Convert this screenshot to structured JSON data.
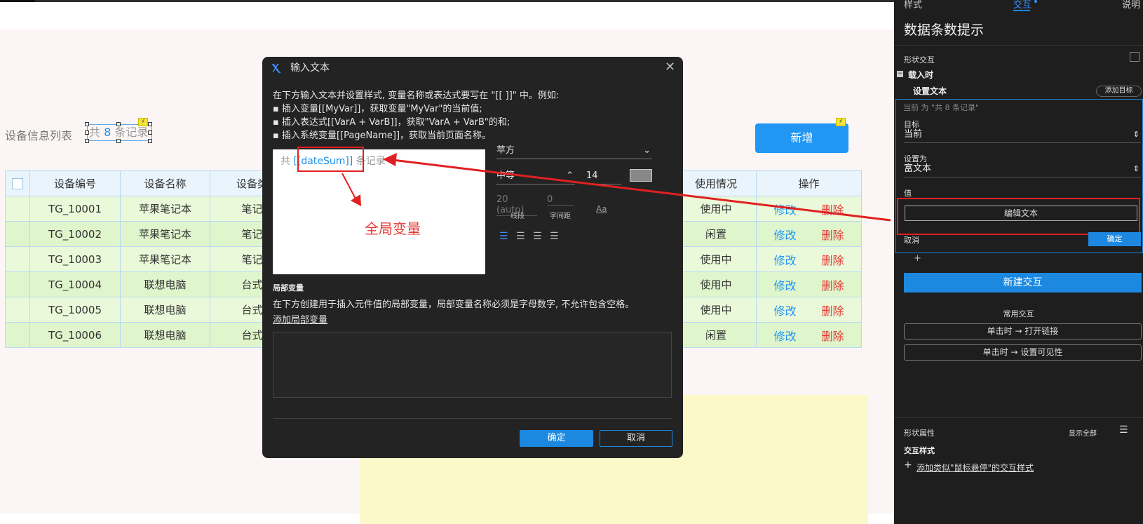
{
  "canvas": {
    "list_title": "设备信息列表",
    "count_prefix": "共",
    "count_value": "8",
    "count_suffix": "条记录",
    "add_button": "新增",
    "table": {
      "headers": [
        "设备编号",
        "设备名称",
        "设备类",
        "使用情况",
        "操作"
      ],
      "rows": [
        {
          "id": "TG_10001",
          "name": "苹果笔记本",
          "type": "笔记",
          "status": "使用中"
        },
        {
          "id": "TG_10002",
          "name": "苹果笔记本",
          "type": "笔记",
          "status": "闲置"
        },
        {
          "id": "TG_10003",
          "name": "苹果笔记本",
          "type": "笔记",
          "status": "使用中"
        },
        {
          "id": "TG_10004",
          "name": "联想电脑",
          "type": "台式",
          "status": "使用中"
        },
        {
          "id": "TG_10005",
          "name": "联想电脑",
          "type": "台式",
          "status": "使用中"
        },
        {
          "id": "TG_10006",
          "name": "联想电脑",
          "type": "台式",
          "status": "闲置"
        }
      ],
      "edit_label": "修改",
      "delete_label": "删除"
    }
  },
  "dialog": {
    "title": "输入文本",
    "instructions": [
      "在下方输入文本并设置样式, 变量名称或表达式要写在 \"[[ ]]\" 中。例如:",
      "▪ 插入变量[[MyVar]]，获取变量\"MyVar\"的当前值;",
      "▪ 插入表达式[[VarA + VarB]]，获取\"VarA + VarB\"的和;",
      "▪ 插入系统变量[[PageName]]，获取当前页面名称。"
    ],
    "editor_prefix": "共",
    "editor_var": "[[dateSum]]",
    "editor_suffix": "条记录",
    "annotation": "全局变量",
    "font_family": "苹方",
    "font_weight": "中等",
    "font_size": "14",
    "line_height_value": "20 (auto)",
    "line_height_label": "线段",
    "letter_spacing_value": "0",
    "letter_spacing_label": "字间距",
    "local_var_title": "局部变量",
    "local_var_desc": "在下方创建用于插入元件值的局部变量，局部变量名称必须是字母数字, 不允许包含空格。",
    "add_local_var": "添加局部变量",
    "ok": "确定",
    "cancel": "取消"
  },
  "panel": {
    "tabs": [
      "样式",
      "交互",
      "说明"
    ],
    "title": "数据条数提示",
    "shape_interaction": "形状交互",
    "event": "载入时",
    "action": "设置文本",
    "add_target": "添加目标",
    "current_desc": "当前 为 \"共 8 条记录\"",
    "target_label": "目标",
    "target_value": "当前",
    "set_as_label": "设置为",
    "set_as_value": "富文本",
    "value_label": "值",
    "edit_text": "编辑文本",
    "cancel": "取消",
    "ok": "确定",
    "plus": "+",
    "new_interaction": "新建交互",
    "common_title": "常用交互",
    "common_items": [
      "单击时 → 打开链接",
      "单击时 → 设置可见性"
    ],
    "shape_props": "形状属性",
    "show_all": "显示全部",
    "interaction_style": "交互样式",
    "add_style": "添加类似\"鼠标悬停\"的交互样式"
  }
}
